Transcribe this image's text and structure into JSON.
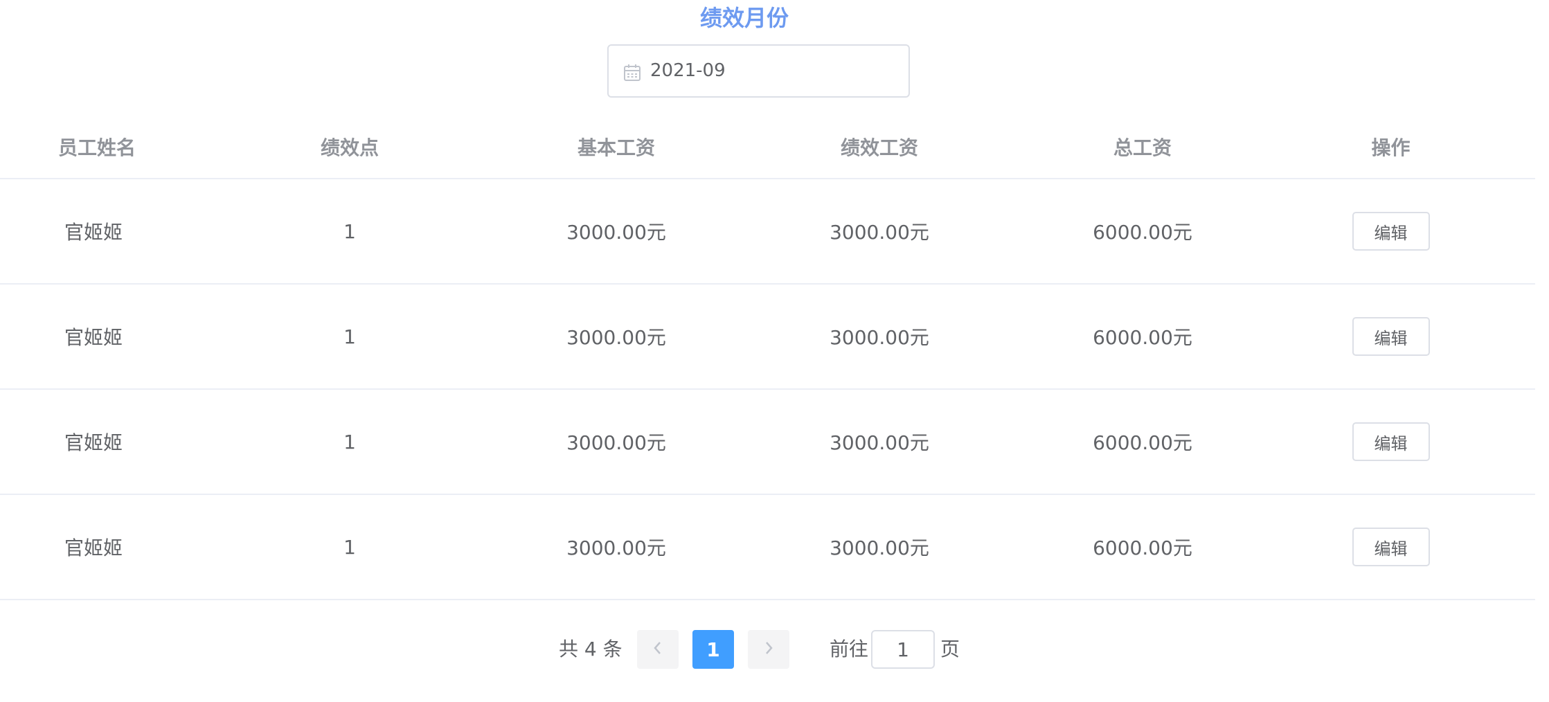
{
  "header": {
    "title": "绩效月份"
  },
  "month_picker": {
    "icon": "calendar-icon",
    "value": "2021-09"
  },
  "table": {
    "columns": [
      "员工姓名",
      "绩效点",
      "基本工资",
      "绩效工资",
      "总工资",
      "操作"
    ],
    "rows": [
      {
        "name": "官姬姬",
        "points": "1",
        "base_salary": "3000.00元",
        "performance_salary": "3000.00元",
        "total_salary": "6000.00元",
        "action": "编辑"
      },
      {
        "name": "官姬姬",
        "points": "1",
        "base_salary": "3000.00元",
        "performance_salary": "3000.00元",
        "total_salary": "6000.00元",
        "action": "编辑"
      },
      {
        "name": "官姬姬",
        "points": "1",
        "base_salary": "3000.00元",
        "performance_salary": "3000.00元",
        "total_salary": "6000.00元",
        "action": "编辑"
      },
      {
        "name": "官姬姬",
        "points": "1",
        "base_salary": "3000.00元",
        "performance_salary": "3000.00元",
        "total_salary": "6000.00元",
        "action": "编辑"
      }
    ]
  },
  "pagination": {
    "total_text": "共 4 条",
    "current_page": "1",
    "goto_label": "前往",
    "goto_value": "1",
    "page_suffix": "页",
    "prev_icon": "chevron-left-icon",
    "next_icon": "chevron-right-icon",
    "active_color": "#409eff"
  },
  "colors": {
    "title": "#6d9af0",
    "header_text": "#909399",
    "body_text": "#606266",
    "border": "#ebeef5"
  }
}
